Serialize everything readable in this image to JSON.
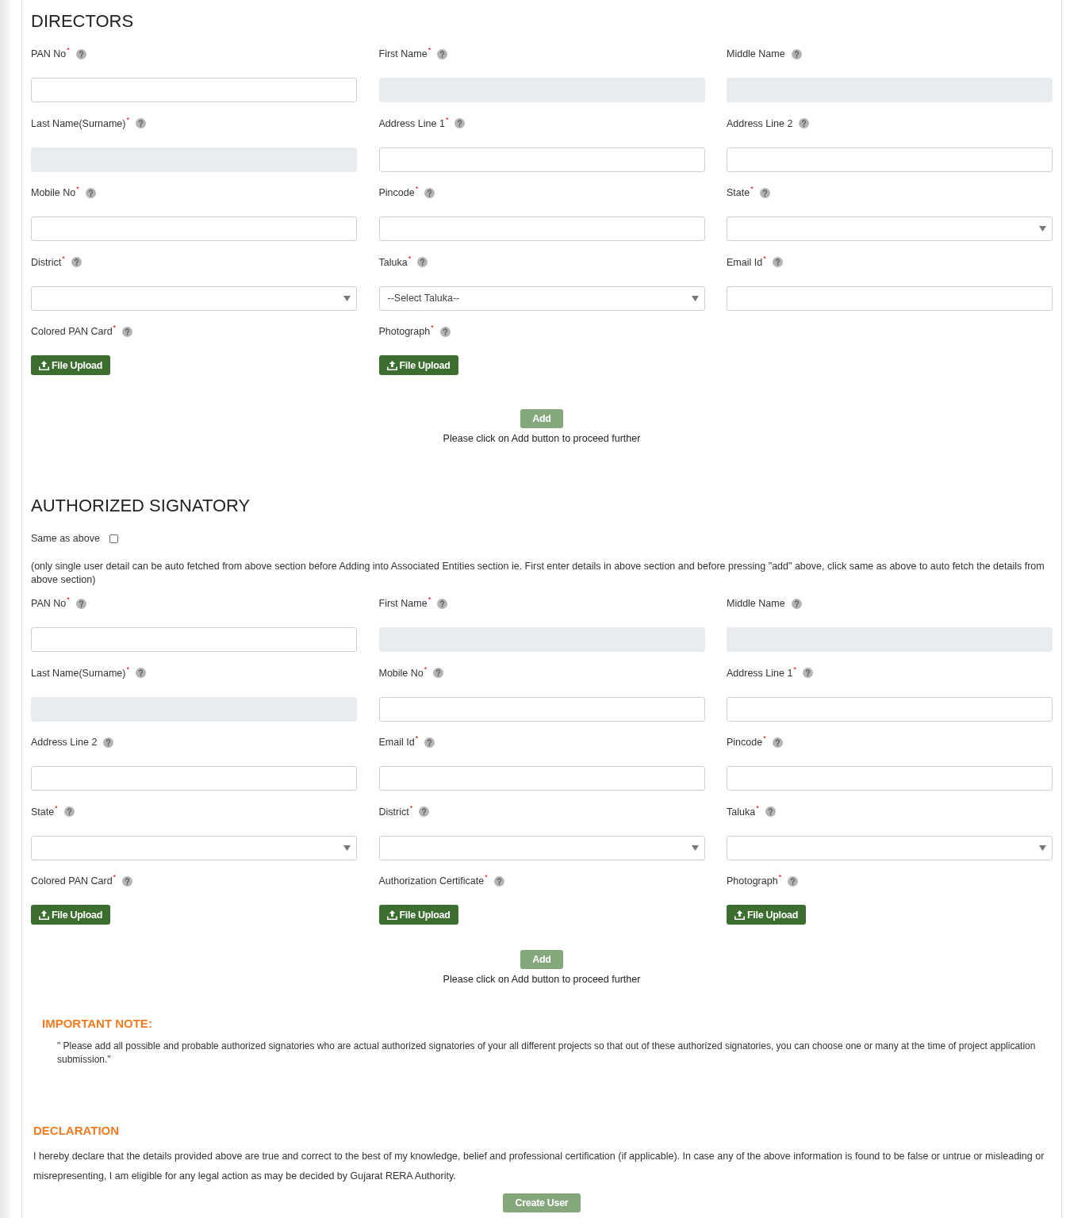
{
  "directors": {
    "title": "DIRECTORS",
    "fields": [
      {
        "kind": "input",
        "label": "PAN No",
        "asterisk": "*",
        "disabled": false
      },
      {
        "kind": "input",
        "label": "First Name",
        "asterisk": "*",
        "disabled": true
      },
      {
        "kind": "input",
        "label": "Middle Name",
        "disabled": true
      },
      {
        "kind": "input",
        "label": "Last Name(Surname)",
        "asterisk": "*",
        "disabled": true
      },
      {
        "kind": "input",
        "label": "Address Line 1",
        "asterisk": "*",
        "disabled": false
      },
      {
        "kind": "input",
        "label": "Address Line 2",
        "disabled": false
      },
      {
        "kind": "input",
        "label": "Mobile No",
        "asterisk": "*",
        "disabled": false
      },
      {
        "kind": "input",
        "label": "Pincode",
        "asterisk": "*",
        "disabled": false
      },
      {
        "kind": "select",
        "label": "State",
        "asterisk": "*",
        "disabled": false
      },
      {
        "kind": "select",
        "label": "District",
        "asterisk": "*",
        "disabled": false
      },
      {
        "kind": "select",
        "label": "Taluka",
        "asterisk": "*",
        "value": "--Select Taluka--",
        "disabled": false
      },
      {
        "kind": "input",
        "label": "Email Id",
        "asterisk": "*",
        "disabled": false
      },
      {
        "kind": "upload",
        "label": "Colored PAN Card",
        "asterisk": "*",
        "button": "File Upload",
        "disabled": false
      },
      {
        "kind": "upload",
        "label": "Photograph",
        "asterisk": "*",
        "button": "File Upload",
        "disabled": false
      }
    ],
    "add_button": {
      "label": "Add",
      "disabled": true
    },
    "hint": "Please click on Add button to proceed further"
  },
  "authorized_signatory": {
    "title": "AUTHORIZED SIGNATORY",
    "same_as_above": {
      "label": "Same as above",
      "checked": false
    },
    "note": "(only single user detail can be auto fetched from above section before Adding into Associated Entities section ie. First enter details in above section and before pressing \"add\" above, click same as above to auto fetch the details from above section)",
    "fields": [
      {
        "kind": "input",
        "label": "PAN No",
        "asterisk": "*",
        "disabled": false
      },
      {
        "kind": "input",
        "label": "First Name",
        "asterisk": "*",
        "disabled": true
      },
      {
        "kind": "input",
        "label": "Middle Name",
        "disabled": true
      },
      {
        "kind": "input",
        "label": "Last Name(Surname)",
        "asterisk": "*",
        "disabled": true
      },
      {
        "kind": "input",
        "label": "Mobile No",
        "asterisk": "*",
        "disabled": false
      },
      {
        "kind": "input",
        "label": "Address Line 1",
        "asterisk": "*",
        "disabled": false
      },
      {
        "kind": "input",
        "label": "Address Line 2",
        "disabled": false
      },
      {
        "kind": "input",
        "label": "Email Id",
        "asterisk": "*",
        "disabled": false
      },
      {
        "kind": "input",
        "label": "Pincode",
        "asterisk": "*",
        "disabled": false
      },
      {
        "kind": "select",
        "label": "State",
        "asterisk": "*",
        "disabled": false
      },
      {
        "kind": "select",
        "label": "District",
        "asterisk": "*",
        "disabled": false
      },
      {
        "kind": "select",
        "label": "Taluka",
        "asterisk": "*",
        "disabled": false
      },
      {
        "kind": "upload",
        "label": "Colored PAN Card",
        "asterisk": "*",
        "button": "File Upload",
        "disabled": false
      },
      {
        "kind": "upload",
        "label": "Authorization Certificate",
        "asterisk": "*",
        "button": "File Upload",
        "disabled": false
      },
      {
        "kind": "upload",
        "label": "Photograph",
        "asterisk": "*",
        "button": "File Upload",
        "disabled": false
      }
    ],
    "add_button": {
      "label": "Add",
      "disabled": true
    },
    "hint": "Please click on Add button to proceed further"
  },
  "important_note": {
    "title": "IMPORTANT NOTE:",
    "text": "\" Please add all possible and probable authorized signatories who are actual authorized signatories of your all different projects so that out of these authorized signatories, you can choose one or many at the time of project application submission.\""
  },
  "declaration": {
    "title": "DECLARATION",
    "text": "I hereby declare that the details provided above are true and correct to the best of my knowledge, belief and professional certification (if applicable). In case any of the above information is found to be false or untrue or misleading or misrepresenting, I am eligible for any legal action as may be decided by Gujarat RERA Authority.",
    "button": {
      "label": "Create User",
      "disabled": true
    }
  }
}
